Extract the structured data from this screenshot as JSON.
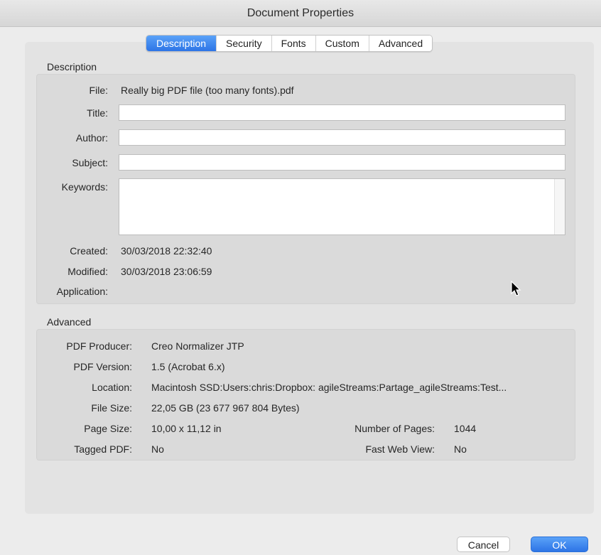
{
  "window": {
    "title": "Document Properties"
  },
  "tabs": [
    "Description",
    "Security",
    "Fonts",
    "Custom",
    "Advanced"
  ],
  "description": {
    "section_label": "Description",
    "file_label": "File:",
    "file_value": "Really big PDF file (too many fonts).pdf",
    "title_label": "Title:",
    "title_value": "",
    "author_label": "Author:",
    "author_value": "",
    "subject_label": "Subject:",
    "subject_value": "",
    "keywords_label": "Keywords:",
    "keywords_value": "",
    "created_label": "Created:",
    "created_value": "30/03/2018 22:32:40",
    "modified_label": "Modified:",
    "modified_value": "30/03/2018 23:06:59",
    "application_label": "Application:",
    "application_value": ""
  },
  "advanced": {
    "section_label": "Advanced",
    "producer_label": "PDF Producer:",
    "producer_value": "Creo Normalizer JTP",
    "version_label": "PDF Version:",
    "version_value": "1.5 (Acrobat 6.x)",
    "location_label": "Location:",
    "location_value": "Macintosh SSD:Users:chris:Dropbox: agileStreams:Partage_agileStreams:Test...",
    "filesize_label": "File Size:",
    "filesize_value": "22,05 GB (23 677 967 804 Bytes)",
    "pagesize_label": "Page Size:",
    "pagesize_value": "10,00 x 11,12 in",
    "numpages_label": "Number of Pages:",
    "numpages_value": "1044",
    "tagged_label": "Tagged PDF:",
    "tagged_value": "No",
    "fastweb_label": "Fast Web View:",
    "fastweb_value": "No"
  },
  "buttons": {
    "cancel": "Cancel",
    "ok": "OK"
  },
  "colors": {
    "accent": "#2d74e6",
    "panel": "#e3e3e3",
    "box": "#dadada"
  }
}
